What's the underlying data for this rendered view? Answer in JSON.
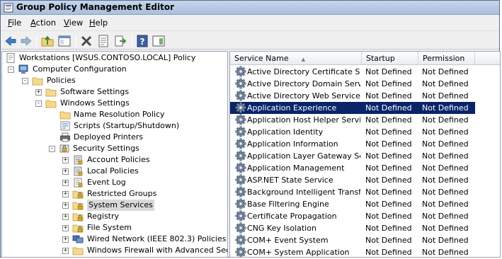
{
  "window": {
    "title": "Group Policy Management Editor",
    "icon": "gpme-app-icon"
  },
  "menu": {
    "items": [
      {
        "label": "File",
        "accel": "F",
        "rest": "ile"
      },
      {
        "label": "Action",
        "accel": "A",
        "rest": "ction"
      },
      {
        "label": "View",
        "accel": "V",
        "rest": "iew"
      },
      {
        "label": "Help",
        "accel": "H",
        "rest": "elp"
      }
    ]
  },
  "toolbar": {
    "buttons": [
      "back-icon",
      "forward-icon",
      "up-folder-icon",
      "show-hide-tree-icon",
      "delete-icon",
      "properties-icon",
      "export-list-icon",
      "help-icon",
      "action-pane-icon"
    ]
  },
  "tree": {
    "nodes": [
      {
        "label": "Workstations [WSUS.CONTOSO.LOCAL] Policy",
        "icon": "policy-document-icon",
        "expander": ""
      },
      {
        "label": "Computer Configuration",
        "icon": "computer-icon",
        "expander": "-"
      },
      {
        "label": "Policies",
        "icon": "folder-icon",
        "expander": "-"
      },
      {
        "label": "Software Settings",
        "icon": "folder-icon",
        "expander": "+"
      },
      {
        "label": "Windows Settings",
        "icon": "folder-icon",
        "expander": "-"
      },
      {
        "label": "Name Resolution Policy",
        "icon": "folder-icon",
        "expander": ""
      },
      {
        "label": "Scripts (Startup/Shutdown)",
        "icon": "scripts-icon",
        "expander": ""
      },
      {
        "label": "Deployed Printers",
        "icon": "printer-icon",
        "expander": ""
      },
      {
        "label": "Security Settings",
        "icon": "security-settings-icon",
        "expander": "-"
      },
      {
        "label": "Account Policies",
        "icon": "policy-book-icon",
        "expander": "+"
      },
      {
        "label": "Local Policies",
        "icon": "policy-book-icon",
        "expander": "+"
      },
      {
        "label": "Event Log",
        "icon": "event-log-icon",
        "expander": "+"
      },
      {
        "label": "Restricted Groups",
        "icon": "locked-folder-icon",
        "expander": "+"
      },
      {
        "label": "System Services",
        "icon": "locked-folder-icon",
        "expander": "+"
      },
      {
        "label": "Registry",
        "icon": "locked-folder-icon",
        "expander": "+"
      },
      {
        "label": "File System",
        "icon": "locked-folder-icon",
        "expander": "+"
      },
      {
        "label": "Wired Network (IEEE 802.3) Policies",
        "icon": "network-icon",
        "expander": "+"
      },
      {
        "label": "Windows Firewall with Advanced Security",
        "icon": "folder-icon",
        "expander": "+"
      }
    ],
    "selected": "System Services"
  },
  "list": {
    "columns": [
      "Service Name",
      "Startup",
      "Permission"
    ],
    "rows": [
      {
        "name": "Active Directory Certificate Se...",
        "startup": "Not Defined",
        "permission": "Not Defined"
      },
      {
        "name": "Active Directory Domain Services",
        "startup": "Not Defined",
        "permission": "Not Defined"
      },
      {
        "name": "Active Directory Web Services",
        "startup": "Not Defined",
        "permission": "Not Defined"
      },
      {
        "name": "Application Experience",
        "startup": "Not Defined",
        "permission": "Not Defined"
      },
      {
        "name": "Application Host Helper Service",
        "startup": "Not Defined",
        "permission": "Not Defined"
      },
      {
        "name": "Application Identity",
        "startup": "Not Defined",
        "permission": "Not Defined"
      },
      {
        "name": "Application Information",
        "startup": "Not Defined",
        "permission": "Not Defined"
      },
      {
        "name": "Application Layer Gateway Ser...",
        "startup": "Not Defined",
        "permission": "Not Defined"
      },
      {
        "name": "Application Management",
        "startup": "Not Defined",
        "permission": "Not Defined"
      },
      {
        "name": "ASP.NET State Service",
        "startup": "Not Defined",
        "permission": "Not Defined"
      },
      {
        "name": "Background Intelligent Transfe...",
        "startup": "Not Defined",
        "permission": "Not Defined"
      },
      {
        "name": "Base Filtering Engine",
        "startup": "Not Defined",
        "permission": "Not Defined"
      },
      {
        "name": "Certificate Propagation",
        "startup": "Not Defined",
        "permission": "Not Defined"
      },
      {
        "name": "CNG Key Isolation",
        "startup": "Not Defined",
        "permission": "Not Defined"
      },
      {
        "name": "COM+ Event System",
        "startup": "Not Defined",
        "permission": "Not Defined"
      },
      {
        "name": "COM+ System Application",
        "startup": "Not Defined",
        "permission": "Not Defined"
      }
    ],
    "selected": "Application Experience",
    "row_icon": "service-gear-icon"
  },
  "colors": {
    "selection": "#0a246a",
    "title_bar": "#b8cbe4"
  }
}
